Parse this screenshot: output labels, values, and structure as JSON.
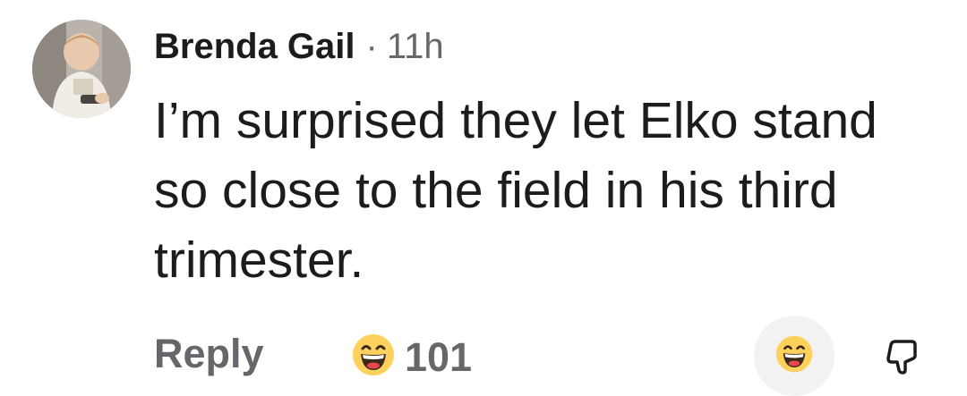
{
  "comment": {
    "author": "Brenda Gail",
    "separator": "·",
    "time": "11h",
    "text": "I’m surprised they let Elko stand so close to the field in his third trimester."
  },
  "actions": {
    "reply_label": "Reply",
    "reaction_icon": "laughing-emoji-icon",
    "reaction_count": "101",
    "react_icon": "laughing-emoji-icon",
    "dislike_icon": "thumbs-down-icon"
  },
  "colors": {
    "text_primary": "#1c1c1c",
    "text_secondary": "#65676b",
    "emoji_yellow": "#ffd15c",
    "react_button_bg": "#f2f2f2"
  }
}
